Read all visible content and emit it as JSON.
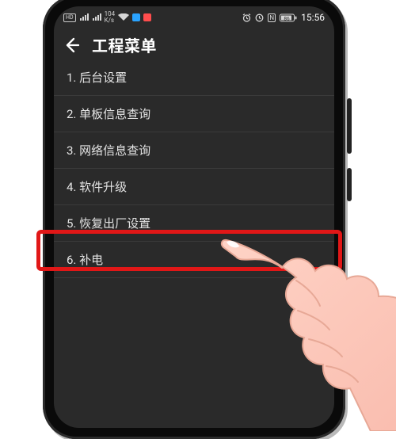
{
  "statusbar": {
    "hd_label": "HD",
    "net_rate": "104",
    "net_unit": "K/s",
    "time": "15:56",
    "battery": "86"
  },
  "header": {
    "title": "工程菜单"
  },
  "menu": {
    "items": [
      {
        "label": "1. 后台设置"
      },
      {
        "label": "2. 单板信息查询"
      },
      {
        "label": "3. 网络信息查询"
      },
      {
        "label": "4. 软件升级"
      },
      {
        "label": "5. 恢复出厂设置"
      },
      {
        "label": "6. 补电"
      }
    ],
    "highlighted_index": 5
  },
  "icons": {
    "back": "back-arrow",
    "hd": "hd-indicator",
    "signal": "signal-bars",
    "wifi": "wifi",
    "notif_msg": "message-icon",
    "notif_app": "app-icon",
    "alarm": "alarm",
    "clock_ic": "clock",
    "nfc": "nfc",
    "battery": "battery",
    "hand": "pointing-hand"
  }
}
